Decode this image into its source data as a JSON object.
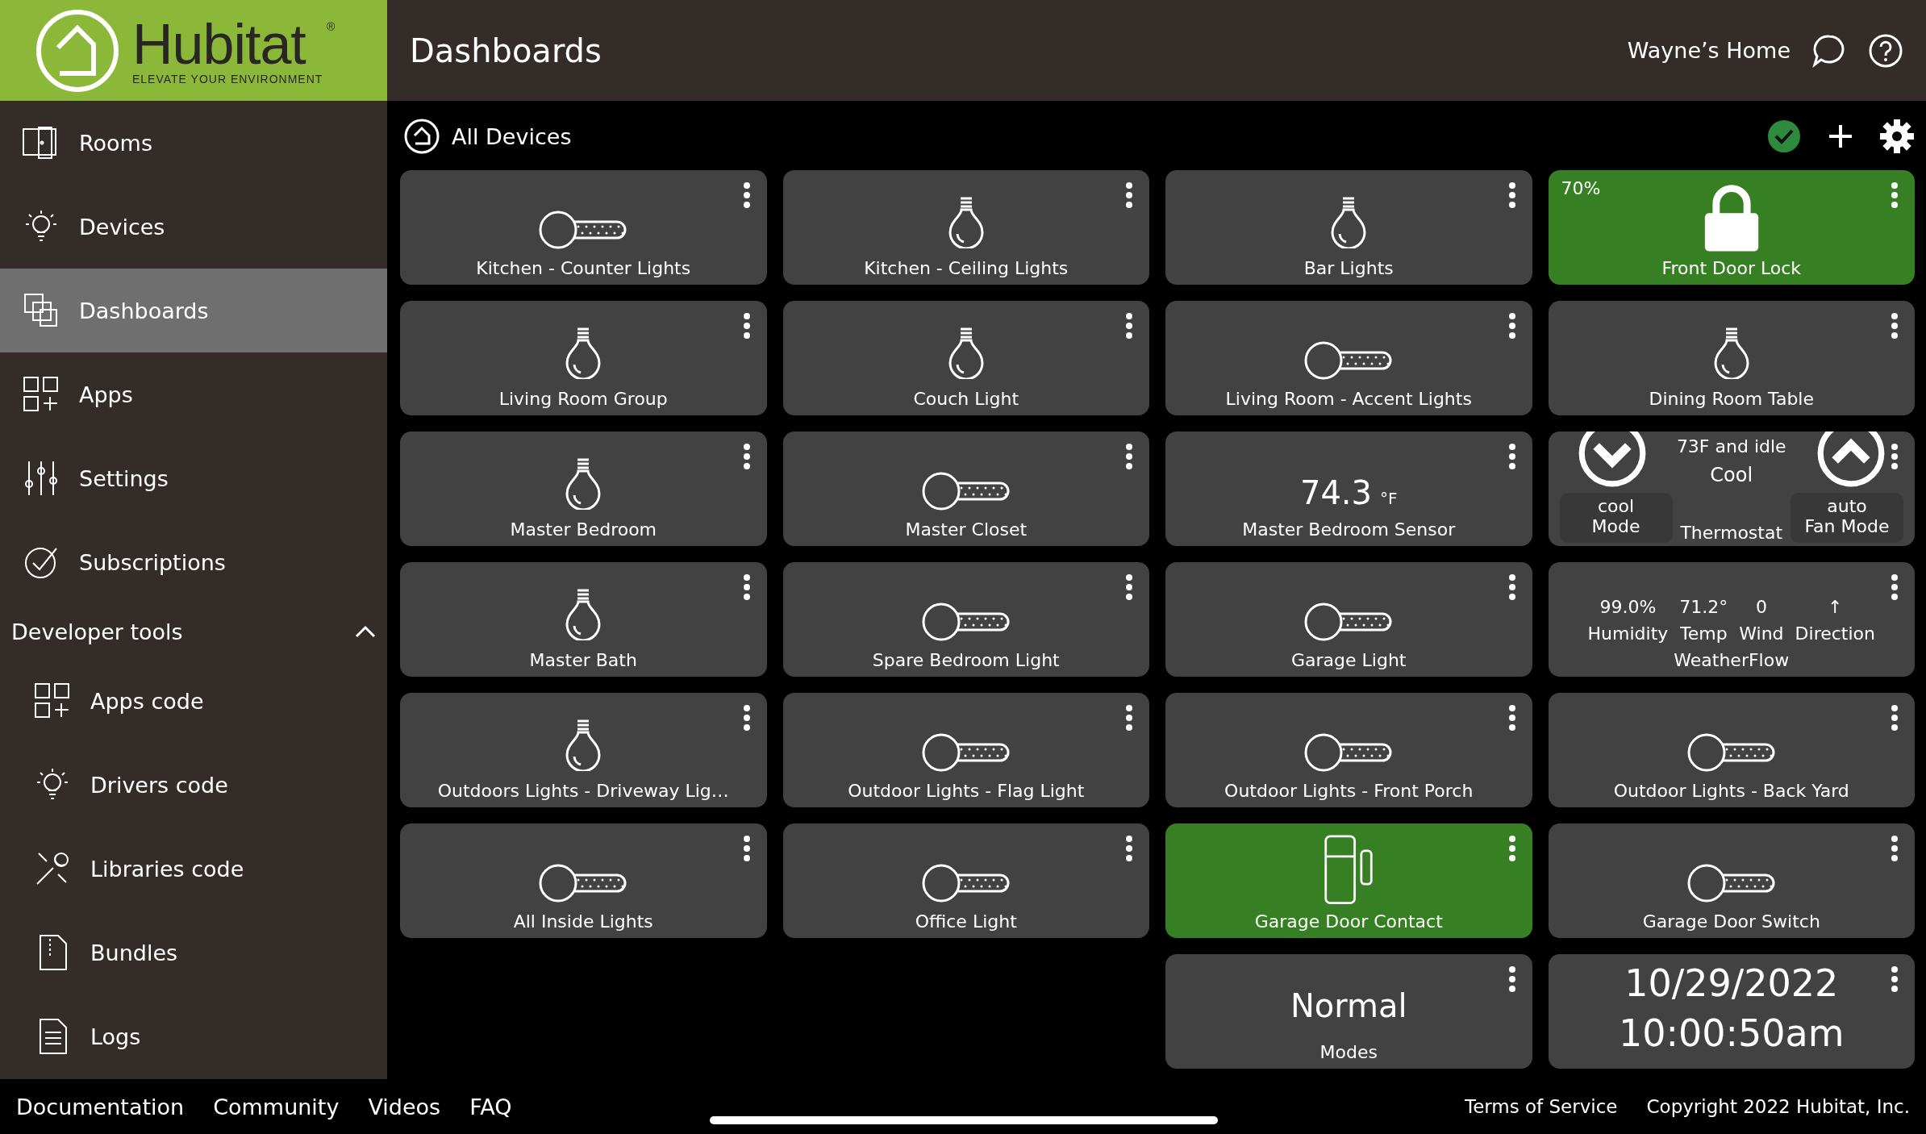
{
  "logo": {
    "name": "Hubitat",
    "tagline": "ELEVATE YOUR ENVIRONMENT",
    "mark": "®"
  },
  "header": {
    "title": "Dashboards",
    "hub_name": "Wayne’s Home"
  },
  "sidebar": {
    "items": [
      {
        "label": "Rooms",
        "selected": false
      },
      {
        "label": "Devices",
        "selected": false
      },
      {
        "label": "Dashboards",
        "selected": true
      },
      {
        "label": "Apps",
        "selected": false
      },
      {
        "label": "Settings",
        "selected": false
      },
      {
        "label": "Subscriptions",
        "selected": false
      }
    ],
    "section": {
      "label": "Developer tools",
      "expanded": true,
      "children": [
        {
          "label": "Apps code",
          "selected": false
        },
        {
          "label": "Drivers code",
          "selected": false
        },
        {
          "label": "Libraries code",
          "selected": false
        },
        {
          "label": "Bundles",
          "selected": false
        },
        {
          "label": "Logs",
          "selected": false
        }
      ]
    }
  },
  "toolbar": {
    "title": "All Devices"
  },
  "tile_rows": [
    [
      {
        "kind": "switch",
        "label": "Kitchen - Counter Lights"
      },
      {
        "kind": "bulb",
        "label": "Kitchen - Ceiling Lights"
      },
      {
        "kind": "bulb",
        "label": "Bar Lights"
      },
      {
        "kind": "lock",
        "label": "Front Door Lock",
        "active": true,
        "corner": "70%"
      }
    ],
    [
      {
        "kind": "bulb",
        "label": "Living Room Group"
      },
      {
        "kind": "bulb",
        "label": "Couch Light"
      },
      {
        "kind": "switch",
        "label": "Living Room - Accent Lights"
      },
      {
        "kind": "bulb",
        "label": "Dining Room Table"
      }
    ],
    [
      {
        "kind": "bulb",
        "label": "Master Bedroom"
      },
      {
        "kind": "switch",
        "label": "Master Closet"
      },
      {
        "kind": "sensor",
        "label": "Master Bedroom Sensor",
        "value": "74.3",
        "unit": "°F"
      },
      {
        "kind": "thermostat",
        "label": "Thermostat",
        "status": "73F and idle",
        "value": "Cool",
        "modes": [
          {
            "value": "cool",
            "name": "Mode"
          },
          {
            "value": "auto",
            "name": "Fan Mode"
          }
        ]
      }
    ],
    [
      {
        "kind": "bulb",
        "label": "Master Bath"
      },
      {
        "kind": "switch",
        "label": "Spare Bedroom Light"
      },
      {
        "kind": "switch",
        "label": "Garage Light"
      },
      {
        "kind": "weather",
        "label": "WeatherFlow",
        "readings": [
          {
            "value": "99.0%",
            "name": "Humidity"
          },
          {
            "value": "71.2°",
            "name": "Temp"
          },
          {
            "value": "0",
            "name": "Wind"
          },
          {
            "value": "↑",
            "name": "Direction"
          }
        ]
      }
    ],
    [
      {
        "kind": "bulb",
        "label": "Outdoors Lights - Driveway Lig…"
      },
      {
        "kind": "switch",
        "label": "Outdoor Lights - Flag Light"
      },
      {
        "kind": "switch",
        "label": "Outdoor Lights - Front Porch"
      },
      {
        "kind": "switch",
        "label": "Outdoor Lights - Back Yard"
      }
    ],
    [
      {
        "kind": "switch",
        "label": "All Inside Lights"
      },
      {
        "kind": "switch",
        "label": "Office Light"
      },
      {
        "kind": "contact",
        "label": "Garage Door Contact",
        "active": true
      },
      {
        "kind": "switch",
        "label": "Garage Door Switch"
      }
    ],
    [
      {
        "kind": "mode",
        "label": "Modes",
        "value": "Normal"
      },
      {
        "kind": "clock",
        "date": "10/29/2022",
        "time": "10:00:50am"
      }
    ]
  ],
  "footer": {
    "links": [
      "Documentation",
      "Community",
      "Videos",
      "FAQ"
    ],
    "right": [
      "Terms of Service",
      "Copyright 2022 Hubitat, Inc."
    ]
  }
}
